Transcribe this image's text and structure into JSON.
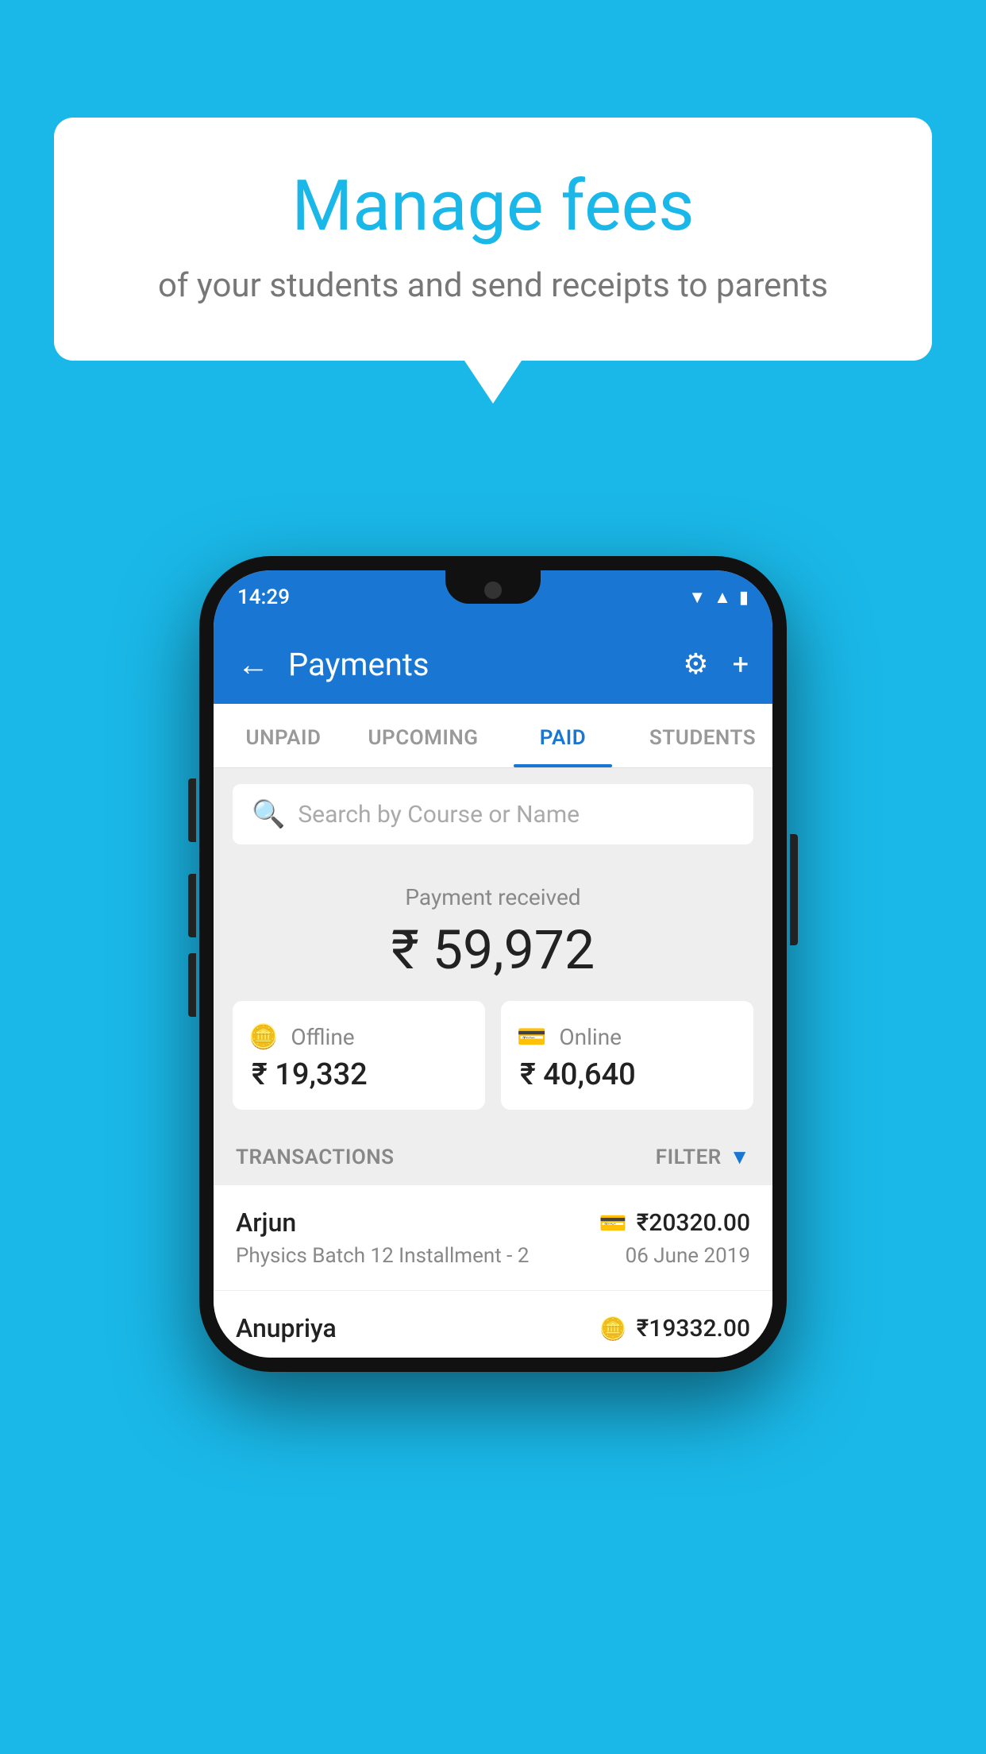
{
  "background_color": "#1ab8e8",
  "speech_bubble": {
    "title": "Manage fees",
    "subtitle": "of your students and send receipts to parents"
  },
  "phone": {
    "status_bar": {
      "time": "14:29"
    },
    "header": {
      "title": "Payments",
      "back_label": "←",
      "settings_label": "⚙",
      "add_label": "+"
    },
    "tabs": [
      {
        "label": "UNPAID",
        "active": false
      },
      {
        "label": "UPCOMING",
        "active": false
      },
      {
        "label": "PAID",
        "active": true
      },
      {
        "label": "STUDENTS",
        "active": false
      }
    ],
    "search": {
      "placeholder": "Search by Course or Name"
    },
    "payment_summary": {
      "label": "Payment received",
      "total": "₹ 59,972",
      "offline_label": "Offline",
      "offline_amount": "₹ 19,332",
      "online_label": "Online",
      "online_amount": "₹ 40,640"
    },
    "transactions_section": {
      "label": "TRANSACTIONS",
      "filter_label": "FILTER"
    },
    "transactions": [
      {
        "name": "Arjun",
        "amount": "₹20320.00",
        "course": "Physics Batch 12 Installment - 2",
        "date": "06 June 2019",
        "payment_type": "card"
      },
      {
        "name": "Anupriya",
        "amount": "₹19332.00",
        "course": "",
        "date": "",
        "payment_type": "cash"
      }
    ]
  }
}
